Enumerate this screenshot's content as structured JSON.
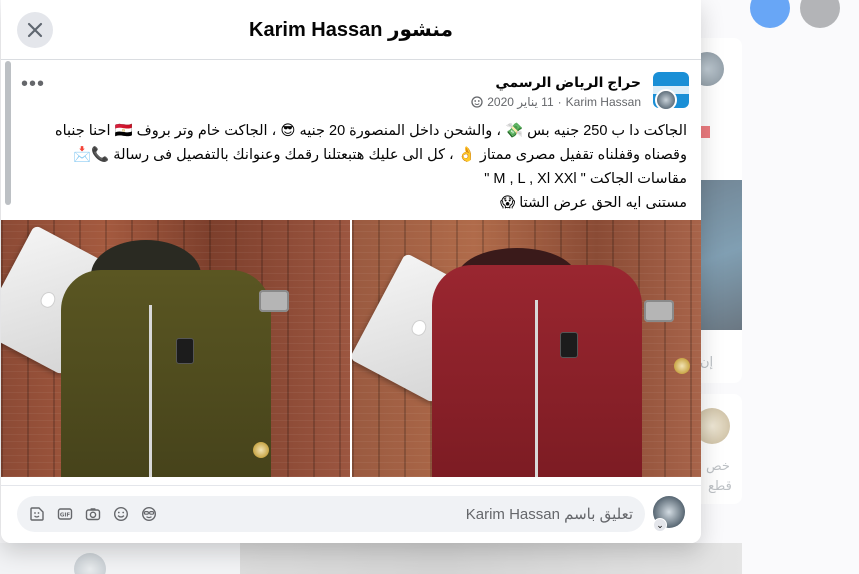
{
  "modal": {
    "title": "منشور Karim Hassan"
  },
  "post": {
    "page_name": "حراج الرياض الرسمي",
    "author": "Karim Hassan",
    "date": "11 يناير 2020",
    "meta_separator": "·",
    "lines": [
      "الجاكت دا ب 250 جنيه بس 💸 ، والشحن داخل المنصورة 20 جنيه 😎 ، الجاكت خام وتر بروف 🇪🇬 احنا جنباه",
      "وقصناه وقفلناه تقفيل مصرى ممتاز 👌 ، كل الى عليك هتبعتلنا رقمك وعنوانك بالتفصيل فى رسالة 📞📩",
      "مقاسات الجاكت \" M , L , Xl  XXl \"",
      "مستنى ايه الحق عرض الشتا 😱"
    ],
    "photos": [
      {
        "desc": "olive jacket",
        "color": "#4d4a1c"
      },
      {
        "desc": "red jacket",
        "color": "#8a1f26"
      }
    ]
  },
  "composer": {
    "placeholder": "تعليق باسم Karim Hassan",
    "icons": [
      "sticker-icon",
      "gif-icon",
      "camera-icon",
      "emoji-icon",
      "avatar-sticker-icon"
    ]
  },
  "background": {
    "snippet_a": "إن",
    "snippet_b": "خص",
    "snippet_c": "قطع"
  },
  "colors": {
    "accent": "#1877f2",
    "text": "#050505",
    "muted": "#65676b"
  }
}
